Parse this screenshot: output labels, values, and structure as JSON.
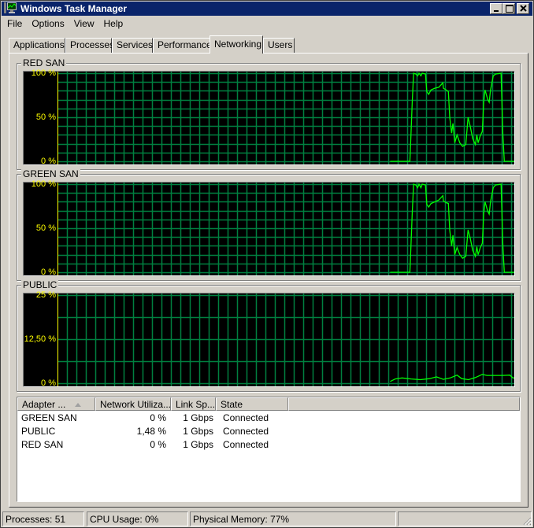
{
  "window": {
    "title": "Windows Task Manager",
    "controls": {
      "minimize": "minimize-icon",
      "maximize": "maximize-icon",
      "close": "close-icon"
    }
  },
  "menu": [
    "File",
    "Options",
    "View",
    "Help"
  ],
  "tabs": [
    {
      "label": "Applications",
      "active": false
    },
    {
      "label": "Processes",
      "active": false
    },
    {
      "label": "Services",
      "active": false
    },
    {
      "label": "Performance",
      "active": false
    },
    {
      "label": "Networking",
      "active": true
    },
    {
      "label": "Users",
      "active": false
    }
  ],
  "colors": {
    "graph_bg": "#000000",
    "grid": "#008040",
    "line": "#00ff00",
    "axis_label": "#ffff00",
    "titlebar": "#0a246a"
  },
  "chart_data": [
    {
      "type": "line",
      "title": "RED SAN",
      "ylabel_ticks": [
        "100 %",
        "50 %",
        "0 %"
      ],
      "ylim": [
        0,
        100
      ],
      "xlim": [
        0,
        100
      ],
      "grid": true,
      "series": [
        {
          "name": "RED SAN utilization",
          "points": [
            [
              72.4,
              0
            ],
            [
              76.7,
              0
            ],
            [
              76.8,
              12
            ],
            [
              77.2,
              65
            ],
            [
              77.5,
              100
            ],
            [
              78.0,
              99
            ],
            [
              78.4,
              97
            ],
            [
              78.7,
              100
            ],
            [
              79.1,
              97
            ],
            [
              79.4,
              100
            ],
            [
              80.1,
              99
            ],
            [
              80.4,
              79
            ],
            [
              80.8,
              76
            ],
            [
              81.3,
              81
            ],
            [
              82.2,
              83
            ],
            [
              83.0,
              84
            ],
            [
              83.9,
              89
            ],
            [
              84.0,
              83
            ],
            [
              84.6,
              81
            ],
            [
              85.1,
              79
            ],
            [
              85.4,
              50
            ],
            [
              85.8,
              32
            ],
            [
              86.1,
              43
            ],
            [
              86.5,
              21
            ],
            [
              87.0,
              30
            ],
            [
              87.6,
              21
            ],
            [
              88.2,
              17
            ],
            [
              88.9,
              19
            ],
            [
              89.4,
              50
            ],
            [
              89.9,
              39
            ],
            [
              90.4,
              26
            ],
            [
              91.0,
              19
            ],
            [
              91.3,
              30
            ],
            [
              91.6,
              21
            ],
            [
              92.0,
              28
            ],
            [
              92.5,
              34
            ],
            [
              92.8,
              67
            ],
            [
              93.1,
              81
            ],
            [
              93.7,
              70
            ],
            [
              94.0,
              67
            ],
            [
              94.3,
              81
            ],
            [
              94.9,
              97
            ],
            [
              95.4,
              99
            ],
            [
              96.6,
              100
            ],
            [
              97.0,
              30
            ],
            [
              97.3,
              0
            ],
            [
              100,
              0
            ]
          ]
        }
      ]
    },
    {
      "type": "line",
      "title": "GREEN SAN",
      "ylabel_ticks": [
        "100 %",
        "50 %",
        "0 %"
      ],
      "ylim": [
        0,
        100
      ],
      "xlim": [
        0,
        100
      ],
      "grid": true,
      "series": [
        {
          "name": "GREEN SAN utilization",
          "points": [
            [
              72.4,
              0
            ],
            [
              76.7,
              0
            ],
            [
              76.8,
              12
            ],
            [
              77.2,
              65
            ],
            [
              77.5,
              100
            ],
            [
              78.0,
              99
            ],
            [
              78.4,
              96
            ],
            [
              78.7,
              100
            ],
            [
              79.1,
              96
            ],
            [
              79.4,
              100
            ],
            [
              80.1,
              99
            ],
            [
              80.4,
              77
            ],
            [
              80.8,
              74
            ],
            [
              81.3,
              78
            ],
            [
              82.2,
              80
            ],
            [
              83.0,
              82
            ],
            [
              83.9,
              87
            ],
            [
              84.0,
              81
            ],
            [
              84.6,
              79
            ],
            [
              85.1,
              78
            ],
            [
              85.4,
              48
            ],
            [
              85.8,
              30
            ],
            [
              86.1,
              42
            ],
            [
              86.5,
              20
            ],
            [
              87.0,
              28
            ],
            [
              87.6,
              20
            ],
            [
              88.2,
              16
            ],
            [
              88.9,
              18
            ],
            [
              89.4,
              48
            ],
            [
              89.9,
              38
            ],
            [
              90.4,
              25
            ],
            [
              91.0,
              18
            ],
            [
              91.3,
              29
            ],
            [
              91.6,
              20
            ],
            [
              92.0,
              27
            ],
            [
              92.5,
              33
            ],
            [
              92.8,
              66
            ],
            [
              93.1,
              80
            ],
            [
              93.7,
              69
            ],
            [
              94.0,
              66
            ],
            [
              94.3,
              80
            ],
            [
              94.9,
              96
            ],
            [
              95.4,
              99
            ],
            [
              96.6,
              100
            ],
            [
              97.0,
              30
            ],
            [
              97.3,
              0
            ],
            [
              100,
              0
            ]
          ]
        }
      ]
    },
    {
      "type": "line",
      "title": "PUBLIC",
      "ylabel_ticks": [
        "25 %",
        "12,50 %",
        "0 %"
      ],
      "ylim": [
        0,
        25
      ],
      "xlim": [
        0,
        100
      ],
      "grid": true,
      "series": [
        {
          "name": "PUBLIC utilization",
          "points": [
            [
              72.4,
              0.5
            ],
            [
              73.5,
              1.2
            ],
            [
              75,
              1.5
            ],
            [
              77,
              1.2
            ],
            [
              79,
              1.0
            ],
            [
              81,
              1.3
            ],
            [
              82.5,
              1.8
            ],
            [
              84,
              1.1
            ],
            [
              85.5,
              1.5
            ],
            [
              87,
              2.3
            ],
            [
              88,
              1.3
            ],
            [
              89.5,
              1.0
            ],
            [
              91,
              1.6
            ],
            [
              92.5,
              2.5
            ],
            [
              93.5,
              2.2
            ],
            [
              95,
              2.2
            ],
            [
              97,
              2.2
            ],
            [
              98.5,
              2.3
            ],
            [
              99.2,
              1.5
            ],
            [
              100,
              1.5
            ]
          ]
        }
      ]
    }
  ],
  "public_spikes_note": "",
  "adapters": {
    "columns": [
      "Adapter ...",
      "Network Utiliza...",
      "Link Sp...",
      "State",
      ""
    ],
    "sort_column": 0,
    "rows": [
      {
        "name": "GREEN SAN",
        "utilization": "0 %",
        "link_speed": "1 Gbps",
        "state": "Connected"
      },
      {
        "name": "PUBLIC",
        "utilization": "1,48 %",
        "link_speed": "1 Gbps",
        "state": "Connected"
      },
      {
        "name": "RED SAN",
        "utilization": "0 %",
        "link_speed": "1 Gbps",
        "state": "Connected"
      }
    ]
  },
  "status": {
    "processes": "Processes: 51",
    "cpu": "CPU Usage: 0%",
    "memory": "Physical Memory: 77%",
    "extra": ""
  }
}
